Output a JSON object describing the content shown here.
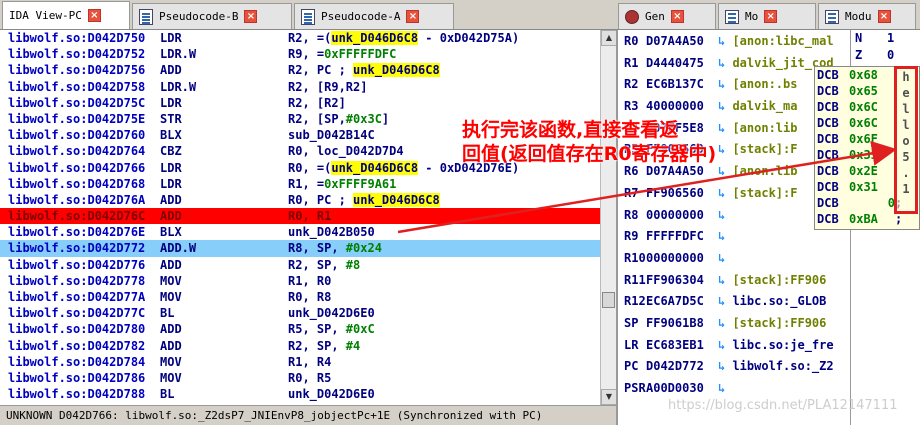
{
  "tabs_left": [
    {
      "label": "IDA View-PC",
      "active": true,
      "icon": "none"
    },
    {
      "label": "Pseudocode-B",
      "active": false,
      "icon": "document-icon"
    },
    {
      "label": "Pseudocode-A",
      "active": false,
      "icon": "document-icon"
    }
  ],
  "tabs_right": [
    {
      "label": "Gen",
      "icon": "bug-icon"
    },
    {
      "label": "Mo",
      "icon": "lines-icon"
    },
    {
      "label": "Modu",
      "icon": "lines-icon"
    }
  ],
  "disassembly": [
    {
      "addr": "libwolf.so:D042D750",
      "mnem": "LDR",
      "pre": "R2, =(",
      "hl": "unk_D046D6C8",
      "post": " - 0xD042D75A)",
      "style": ""
    },
    {
      "addr": "libwolf.so:D042D752",
      "mnem": "LDR.W",
      "pre": "R9, =",
      "num": "0xFFFFFDFC",
      "style": ""
    },
    {
      "addr": "libwolf.so:D042D756",
      "mnem": "ADD",
      "pre": "R2, PC ; ",
      "hl": "unk_D046D6C8",
      "style": ""
    },
    {
      "addr": "libwolf.so:D042D758",
      "mnem": "LDR.W",
      "pre": "R2, [R9,R2]",
      "style": ""
    },
    {
      "addr": "libwolf.so:D042D75C",
      "mnem": "LDR",
      "pre": "R2, [R2]",
      "style": ""
    },
    {
      "addr": "libwolf.so:D042D75E",
      "mnem": "STR",
      "pre": "R2, [SP,",
      "num": "#0x3C",
      "post": "]",
      "style": ""
    },
    {
      "addr": "libwolf.so:D042D760",
      "mnem": "BLX",
      "pre": "sub_D042B14C",
      "style": ""
    },
    {
      "addr": "libwolf.so:D042D764",
      "mnem": "CBZ",
      "pre": "R0, loc_D042D7D4",
      "style": ""
    },
    {
      "addr": "libwolf.so:D042D766",
      "mnem": "LDR",
      "pre": "R0, =(",
      "hl": "unk_D046D6C8",
      "post": " - 0xD042D76E)",
      "style": ""
    },
    {
      "addr": "libwolf.so:D042D768",
      "mnem": "LDR",
      "pre": "R1, =",
      "num": "0xFFFF9A61",
      "style": ""
    },
    {
      "addr": "libwolf.so:D042D76A",
      "mnem": "ADD",
      "pre": "R0, PC ; ",
      "hl": "unk_D046D6C8",
      "style": ""
    },
    {
      "addr": "libwolf.so:D042D76C",
      "mnem": "ADD",
      "pre": "R0, R1",
      "style": "red"
    },
    {
      "addr": "libwolf.so:D042D76E",
      "mnem": "BLX",
      "pre": "unk_D042B050",
      "style": ""
    },
    {
      "addr": "libwolf.so:D042D772",
      "mnem": "ADD.W",
      "pre": "R8, SP, ",
      "num": "#0x24",
      "style": "blue"
    },
    {
      "addr": "libwolf.so:D042D776",
      "mnem": "ADD",
      "pre": "R2, SP, ",
      "num": "#8",
      "style": ""
    },
    {
      "addr": "libwolf.so:D042D778",
      "mnem": "MOV",
      "pre": "R1, R0",
      "style": ""
    },
    {
      "addr": "libwolf.so:D042D77A",
      "mnem": "MOV",
      "pre": "R0, R8",
      "style": ""
    },
    {
      "addr": "libwolf.so:D042D77C",
      "mnem": "BL",
      "pre": "unk_D042D6E0",
      "style": ""
    },
    {
      "addr": "libwolf.so:D042D780",
      "mnem": "ADD",
      "pre": "R5, SP, ",
      "num": "#0xC",
      "style": ""
    },
    {
      "addr": "libwolf.so:D042D782",
      "mnem": "ADD",
      "pre": "R2, SP, ",
      "num": "#4",
      "style": ""
    },
    {
      "addr": "libwolf.so:D042D784",
      "mnem": "MOV",
      "pre": "R1, R4",
      "style": ""
    },
    {
      "addr": "libwolf.so:D042D786",
      "mnem": "MOV",
      "pre": "R0, R5",
      "style": ""
    },
    {
      "addr": "libwolf.so:D042D788",
      "mnem": "BL",
      "pre": "unk_D042D6E0",
      "style": ""
    }
  ],
  "status": "UNKNOWN D042D766: libwolf.so:_Z2dsP7_JNIEnvP8_jobjectPc+1E (Synchronized with PC)",
  "registers": [
    {
      "name": "R0",
      "value": "D07A4A50",
      "desc": "[anon:libc_mal",
      "blue": false
    },
    {
      "name": "R1",
      "value": "D4440475",
      "desc": "dalvik_jit_cod",
      "blue": false
    },
    {
      "name": "R2",
      "value": "EC6B137C",
      "desc": "[anon:.bs",
      "blue": false
    },
    {
      "name": "R3",
      "value": "40000000",
      "desc": "dalvik_ma",
      "blue": false
    },
    {
      "name": "R4",
      "value": "D07EF5E8",
      "desc": "[anon:lib",
      "blue": false
    },
    {
      "name": "R5",
      "value": "FF906560",
      "desc": "[stack]:F",
      "blue": false
    },
    {
      "name": "R6",
      "value": "D07A4A50",
      "desc": "[anon:lib",
      "blue": false
    },
    {
      "name": "R7",
      "value": "FF906560",
      "desc": "[stack]:F",
      "blue": false
    },
    {
      "name": "R8",
      "value": "00000000",
      "desc": "",
      "blue": false
    },
    {
      "name": "R9",
      "value": "FFFFFDFC",
      "desc": "",
      "blue": false
    },
    {
      "name": "R10",
      "value": "00000000",
      "desc": "",
      "blue": false
    },
    {
      "name": "R11",
      "value": "FF906304",
      "desc": "[stack]:FF906",
      "blue": false
    },
    {
      "name": "R12",
      "value": "EC6A7D5C",
      "desc": "libc.so:_GLOB",
      "blue": true
    },
    {
      "name": "SP",
      "value": "FF9061B8",
      "desc": "[stack]:FF906",
      "blue": false
    },
    {
      "name": "LR",
      "value": "EC683EB1",
      "desc": "libc.so:je_fre",
      "blue": true
    },
    {
      "name": "PC",
      "value": "D042D772",
      "desc": "libwolf.so:_Z2",
      "blue": true
    },
    {
      "name": "PSR",
      "value": "A00D0030",
      "desc": "",
      "blue": false
    }
  ],
  "flags": [
    {
      "name": "N",
      "value": "1"
    },
    {
      "name": "Z",
      "value": "0"
    }
  ],
  "hex_dump": [
    {
      "op": "DCB",
      "val": "0x68",
      "ch": "h"
    },
    {
      "op": "DCB",
      "val": "0x65",
      "ch": "e"
    },
    {
      "op": "DCB",
      "val": "0x6C",
      "ch": "l"
    },
    {
      "op": "DCB",
      "val": "0x6C",
      "ch": "l"
    },
    {
      "op": "DCB",
      "val": "0x6F",
      "ch": "o"
    },
    {
      "op": "DCB",
      "val": "0x35",
      "ch": "5"
    },
    {
      "op": "DCB",
      "val": "0x2E",
      "ch": "."
    },
    {
      "op": "DCB",
      "val": "0x31",
      "ch": "1"
    },
    {
      "op": "DCB",
      "val": "0",
      "ch": ""
    },
    {
      "op": "DCB",
      "val": "0xBA",
      "ch": ""
    }
  ],
  "annotation": {
    "line1": "执行完该函数,直接查看返",
    "line2": "回值(返回值存在R0寄存器中)"
  },
  "watermark": "https://blog.csdn.net/PLA12147111",
  "colors": {
    "highlight_yellow": "#ffff00",
    "row_red": "#ff0000",
    "row_blue": "#87cefa",
    "annotation_red": "#ff0000"
  }
}
